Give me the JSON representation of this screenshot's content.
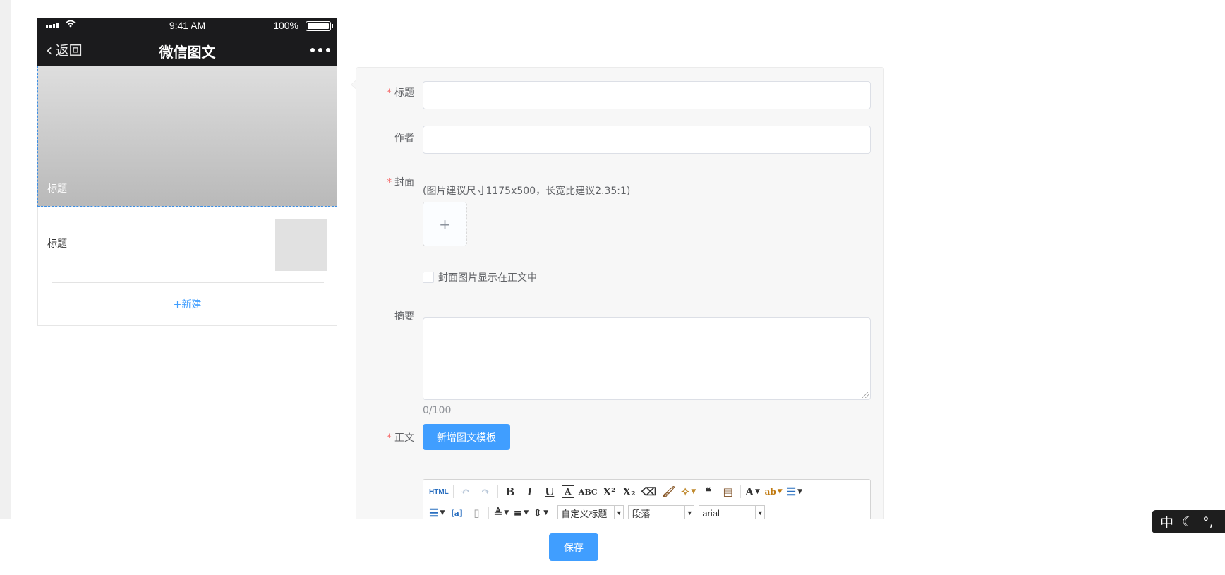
{
  "phone": {
    "status": {
      "time": "9:41 AM",
      "battery": "100%"
    },
    "nav": {
      "back_label": "返回",
      "title": "微信图文"
    },
    "cover_title": "标题",
    "list_item_title": "标题",
    "new_label": "+新建"
  },
  "form": {
    "title_label": "标题",
    "author_label": "作者",
    "cover_label": "封面",
    "cover_hint": "(图片建议尺寸1175x500，长宽比建议2.35:1)",
    "upload_plus": "+",
    "show_cover_label": "封面图片显示在正文中",
    "summary_label": "摘要",
    "summary_counter": "0/100",
    "body_label": "正文",
    "add_template_label": "新增图文模板",
    "required_mark": "*"
  },
  "editor": {
    "html_label": "HTML",
    "heading_select": "自定义标题",
    "paragraph_select": "段落",
    "font_select": "arial"
  },
  "footer": {
    "save_label": "保存"
  },
  "ime": {
    "mode": "中"
  },
  "colors": {
    "primary": "#409eff",
    "required": "#f56c6c",
    "phone_bar": "#1b1b1d"
  }
}
